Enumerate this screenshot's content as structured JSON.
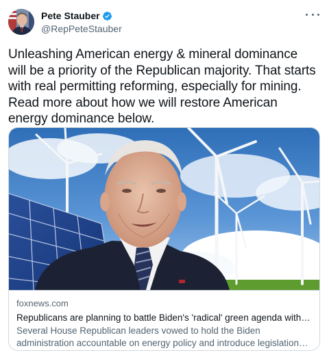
{
  "author": {
    "display_name": "Pete Stauber",
    "handle": "@RepPeteStauber",
    "verified_icon": "verified-badge-icon",
    "avatar_icon": "profile-photo"
  },
  "tweet": {
    "text": "Unleashing American energy & mineral dominance will be a priority of the Republican majority. That starts with real permitting reforming, especially for mining. Read more about how we will restore American energy dominance below."
  },
  "card": {
    "domain": "foxnews.com",
    "title": "Republicans are planning to battle Biden's 'radical' green agenda with House c...",
    "description": "Several House Republican leaders vowed to hold the Biden administration accountable on energy policy and introduce legislation that would boost ..."
  },
  "colors": {
    "text": "#0f1419",
    "secondary": "#536471",
    "verified": "#1d9bf0",
    "border": "#cfd9de"
  },
  "icons": {
    "more": "more-options-icon"
  }
}
